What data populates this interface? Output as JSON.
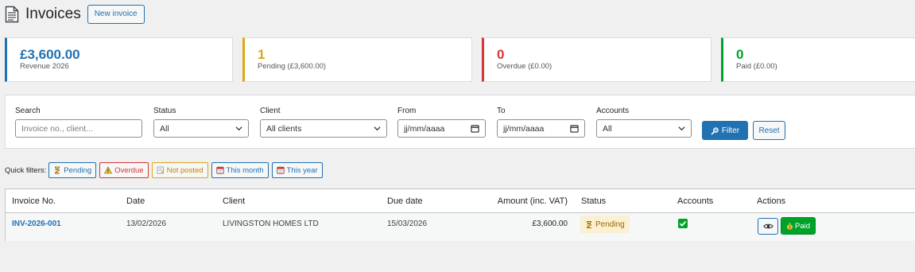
{
  "header": {
    "title": "Invoices",
    "new_button": "New invoice"
  },
  "cards": [
    {
      "value": "£3,600.00",
      "label": "Revenue 2026",
      "color": "#2271b1"
    },
    {
      "value": "1",
      "label": "Pending (£3,600.00)",
      "color": "#dba617"
    },
    {
      "value": "0",
      "label": "Overdue (£0.00)",
      "color": "#d63638"
    },
    {
      "value": "0",
      "label": "Paid (£0.00)",
      "color": "#00a32a"
    }
  ],
  "filters": {
    "search_label": "Search",
    "search_placeholder": "Invoice no., client...",
    "status_label": "Status",
    "status_value": "All",
    "client_label": "Client",
    "client_value": "All clients",
    "from_label": "From",
    "from_placeholder": "jj/mm/aaaa",
    "to_label": "To",
    "to_placeholder": "jj/mm/aaaa",
    "accounts_label": "Accounts",
    "accounts_value": "All",
    "filter_button": "Filter",
    "reset_button": "Reset"
  },
  "quick_filters": {
    "label": "Quick filters:",
    "items": [
      "Pending",
      "Overdue",
      "Not posted",
      "This month",
      "This year"
    ]
  },
  "table": {
    "headers": [
      "Invoice No.",
      "Date",
      "Client",
      "Due date",
      "Amount (inc. VAT)",
      "Status",
      "Accounts",
      "Actions"
    ],
    "rows": [
      {
        "invoice_no": "INV-2026-001",
        "date": "13/02/2026",
        "client": "LIVINGSTON HOMES LTD",
        "due_date": "15/03/2026",
        "amount": "£3,600.00",
        "status": "Pending",
        "paid_button": "Paid"
      }
    ]
  }
}
